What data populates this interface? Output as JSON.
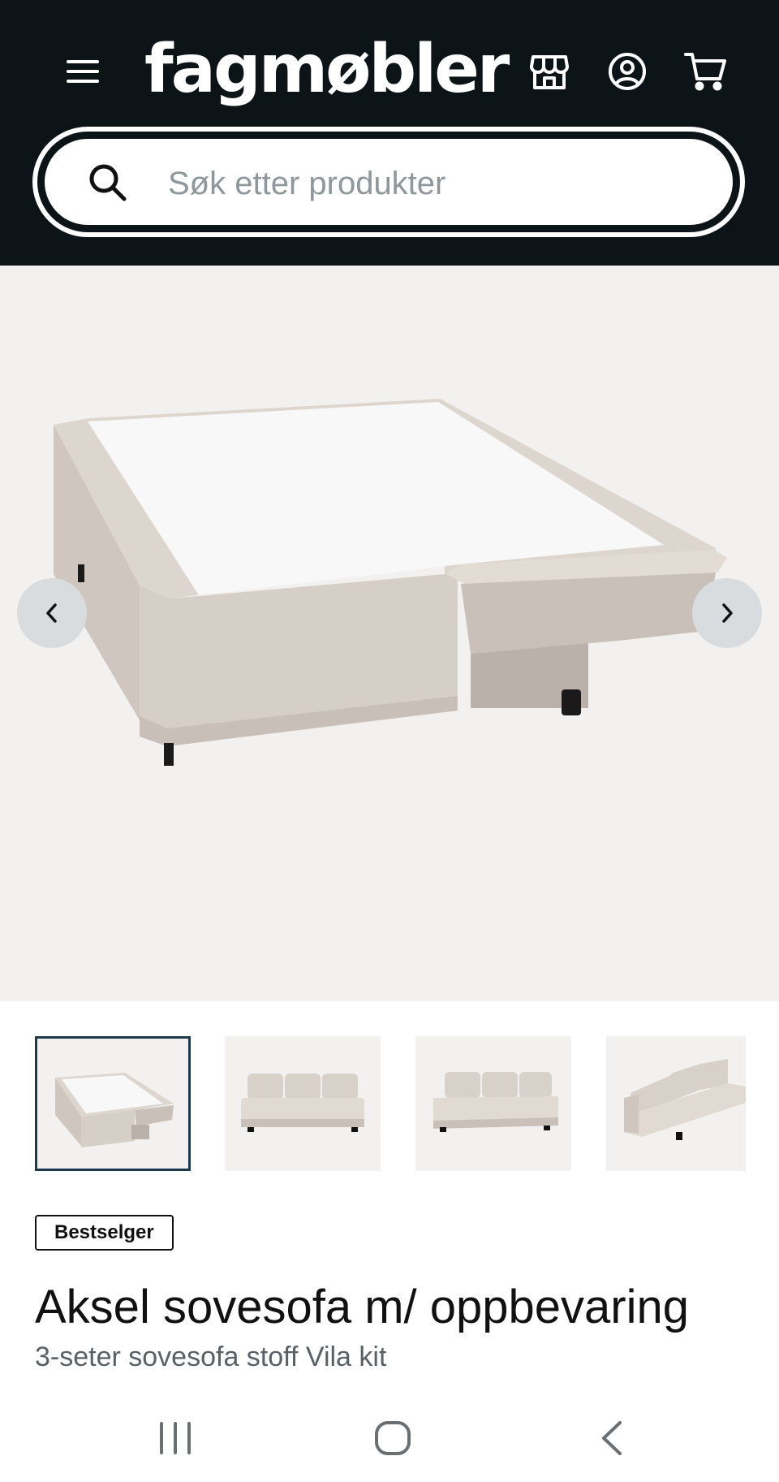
{
  "header": {
    "logo_text": "fagmøbler",
    "menu_icon": "hamburger-menu-icon",
    "store_icon": "store-icon",
    "account_icon": "user-account-icon",
    "cart_icon": "shopping-cart-icon",
    "background_color": "#0c1418"
  },
  "search": {
    "placeholder": "Søk etter produkter",
    "value": ""
  },
  "gallery": {
    "prev_icon": "chevron-left-icon",
    "next_icon": "chevron-right-icon",
    "image_alt": "Aksel sovesofa utfelt som seng",
    "thumbnail_count": 4
  },
  "product": {
    "badge": "Bestselger",
    "title": "Aksel sovesofa m/ oppbevaring",
    "subtitle": "3-seter sovesofa stoff Vila kit",
    "fabric_color": "#d9d2cb"
  },
  "system_nav": {
    "recents_icon": "recent-apps-icon",
    "home_icon": "home-icon",
    "back_icon": "back-icon"
  }
}
